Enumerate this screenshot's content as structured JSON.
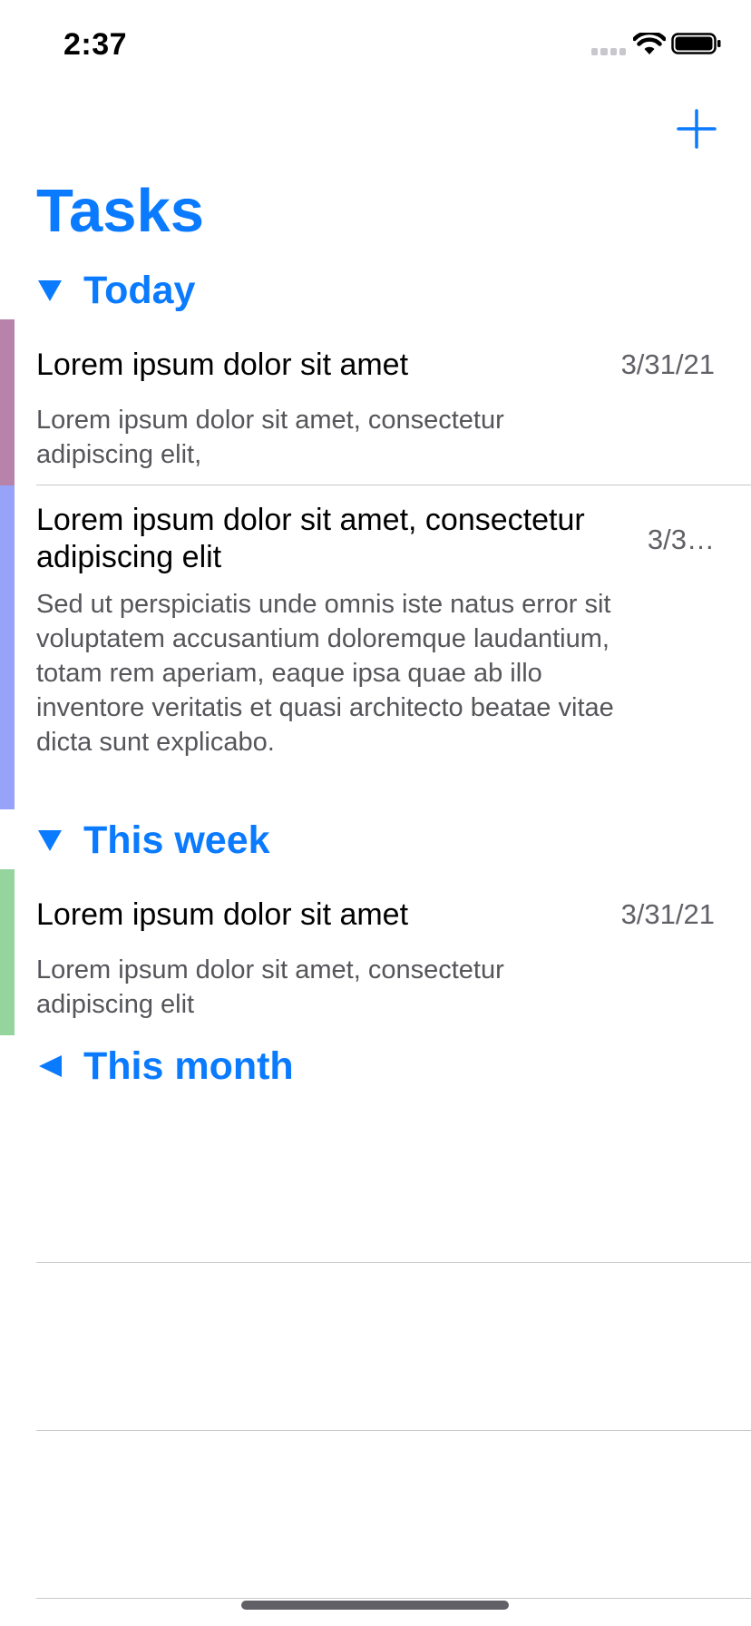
{
  "status_bar": {
    "time": "2:37"
  },
  "nav": {
    "add_icon": "plus-icon"
  },
  "page": {
    "title": "Tasks"
  },
  "colors": {
    "accent": "#0a7aff",
    "stripe_purple": "#b783ab",
    "stripe_blue": "#97a3f8",
    "stripe_green": "#95d49c"
  },
  "sections": [
    {
      "label": "Today",
      "expanded": true,
      "tasks": [
        {
          "title": "Lorem ipsum dolor sit amet",
          "date": "3/31/21",
          "description": "Lorem ipsum dolor sit amet, consectetur adipiscing elit,"
        },
        {
          "title": "Lorem ipsum dolor sit amet, consectetur adipiscing elit",
          "date": "3/3…",
          "description": "Sed ut perspiciatis unde omnis iste natus error sit voluptatem accusantium doloremque laudantium, totam rem aperiam, eaque ipsa quae ab illo inventore veritatis et quasi architecto beatae vitae dicta sunt explicabo."
        }
      ]
    },
    {
      "label": "This week",
      "expanded": true,
      "tasks": [
        {
          "title": "Lorem ipsum dolor sit amet",
          "date": "3/31/21",
          "description": "Lorem ipsum dolor sit amet, consectetur adipiscing elit"
        }
      ]
    },
    {
      "label": "This month",
      "expanded": false,
      "tasks": []
    }
  ]
}
